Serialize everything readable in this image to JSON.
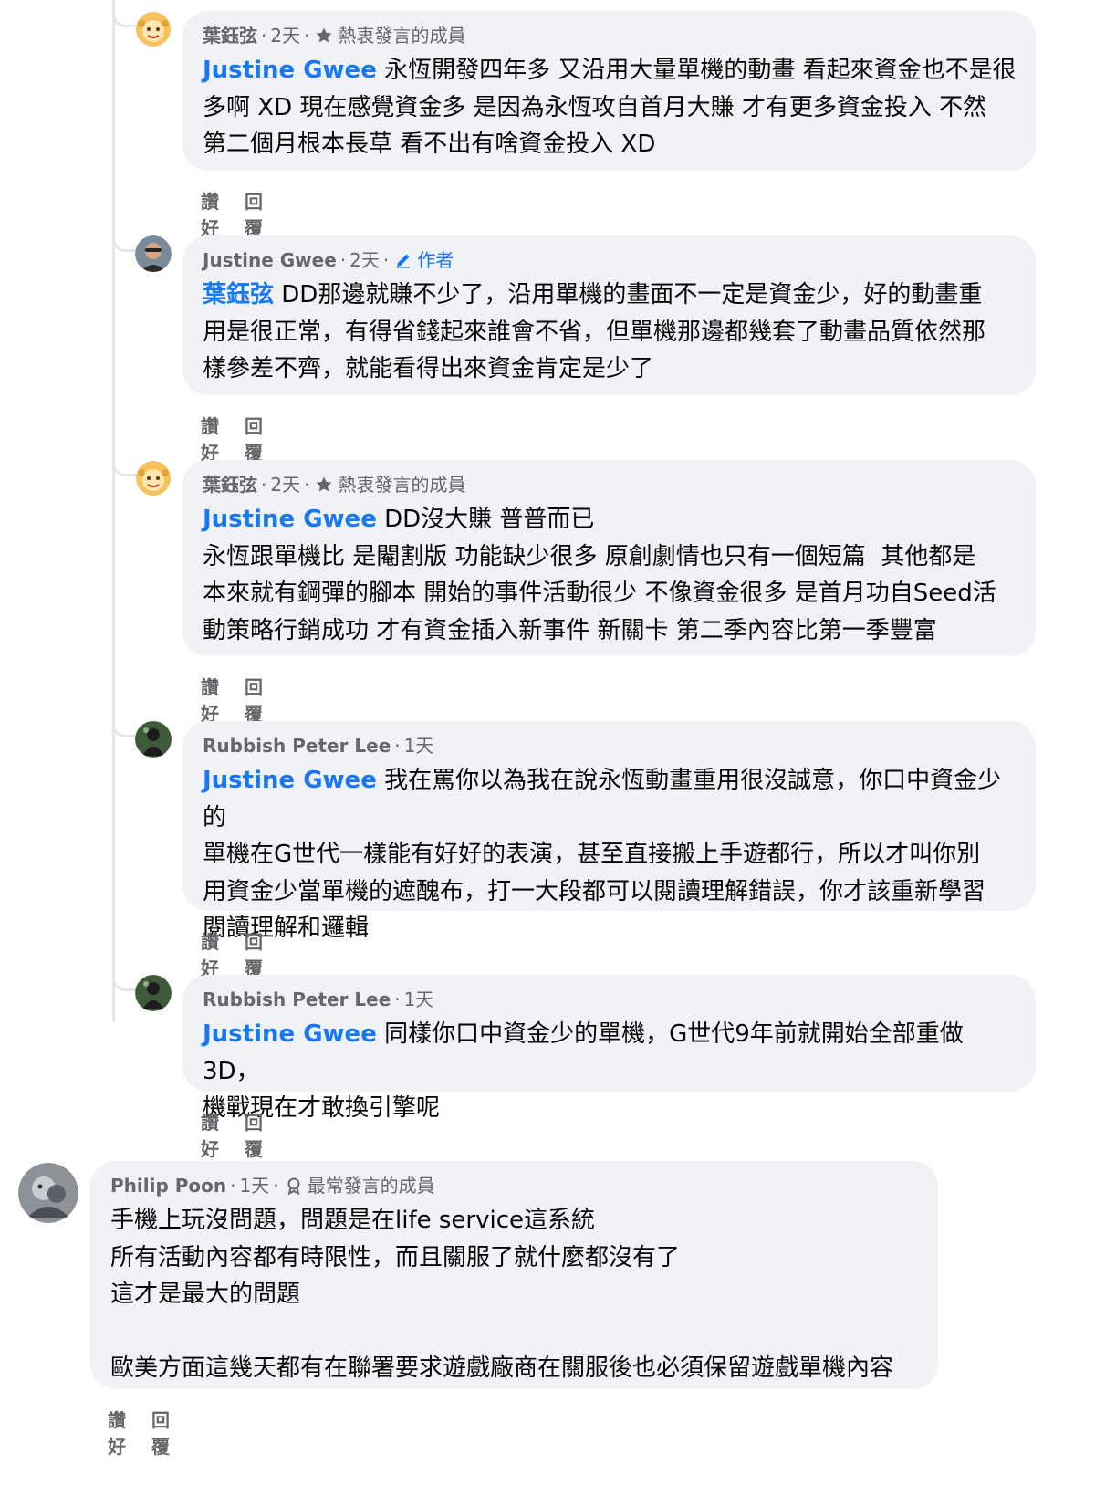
{
  "comments": [
    {
      "author": "葉鈺弦",
      "time": "2天",
      "badge": "熱衷發言的成員",
      "badge_icon": "star-icon",
      "mention": "Justine Gwee",
      "text": " 永恆開發四年多 又沿用大量單機的動畫 看起來資金也不是很\n多啊 XD 現在感覺資金多 是因為永恆攻自首月大賺 才有更多資金投入 不然\n第二個月根本長草 看不出有啥資金投入 XD",
      "like": "讚好",
      "reply": "回覆"
    },
    {
      "author": "Justine Gwee",
      "time": "2天",
      "badge": "作者",
      "badge_icon": "pencil-icon",
      "mention": "葉鈺弦",
      "text": " DD那邊就賺不少了，沿用單機的畫面不一定是資金少，好的動畫重\n用是很正常，有得省錢起來誰會不省，但單機那邊都幾套了動畫品質依然那\n樣參差不齊，就能看得出來資金肯定是少了",
      "like": "讚好",
      "reply": "回覆"
    },
    {
      "author": "葉鈺弦",
      "time": "2天",
      "badge": "熱衷發言的成員",
      "badge_icon": "star-icon",
      "mention": "Justine Gwee",
      "text": " DD沒大賺 普普而已\n永恆跟單機比 是閹割版 功能缺少很多 原創劇情也只有一個短篇  其他都是\n本來就有鋼彈的腳本 開始的事件活動很少 不像資金很多 是首月功自Seed活\n動策略行銷成功 才有資金插入新事件 新關卡 第二季內容比第一季豐富",
      "like": "讚好",
      "reply": "回覆"
    },
    {
      "author": "Rubbish Peter Lee",
      "time": "1天",
      "badge": "",
      "badge_icon": "",
      "mention": "Justine Gwee",
      "text": " 我在罵你以為我在說永恆動畫重用很沒誠意，你口中資金少的\n單機在G世代一樣能有好好的表演，甚至直接搬上手遊都行，所以才叫你別\n用資金少當單機的遮醜布，打一大段都可以閱讀理解錯誤，你才該重新學習\n閱讀理解和邏輯",
      "like": "讚好",
      "reply": "回覆"
    },
    {
      "author": "Rubbish Peter Lee",
      "time": "1天",
      "badge": "",
      "badge_icon": "",
      "mention": "Justine Gwee",
      "text": " 同樣你口中資金少的單機，G世代9年前就開始全部重做3D，\n機戰現在才敢換引擎呢",
      "like": "讚好",
      "reply": "回覆"
    },
    {
      "author": "Philip Poon",
      "time": "1天",
      "badge": "最常發言的成員",
      "badge_icon": "award-icon",
      "mention": "",
      "text": "手機上玩沒問題，問題是在life service這系統\n所有活動內容都有時限性，而且關服了就什麼都沒有了\n這才是最大的問題\n\n歐美方面這幾天都有在聯署要求遊戲廠商在關服後也必須保留遊戲單機內容",
      "like": "讚好",
      "reply": "回覆"
    }
  ],
  "colors": {
    "mention": "#1877f2",
    "bubble": "#f0f2f5",
    "meta": "#65676b",
    "thread_line": "#e4e6eb"
  }
}
